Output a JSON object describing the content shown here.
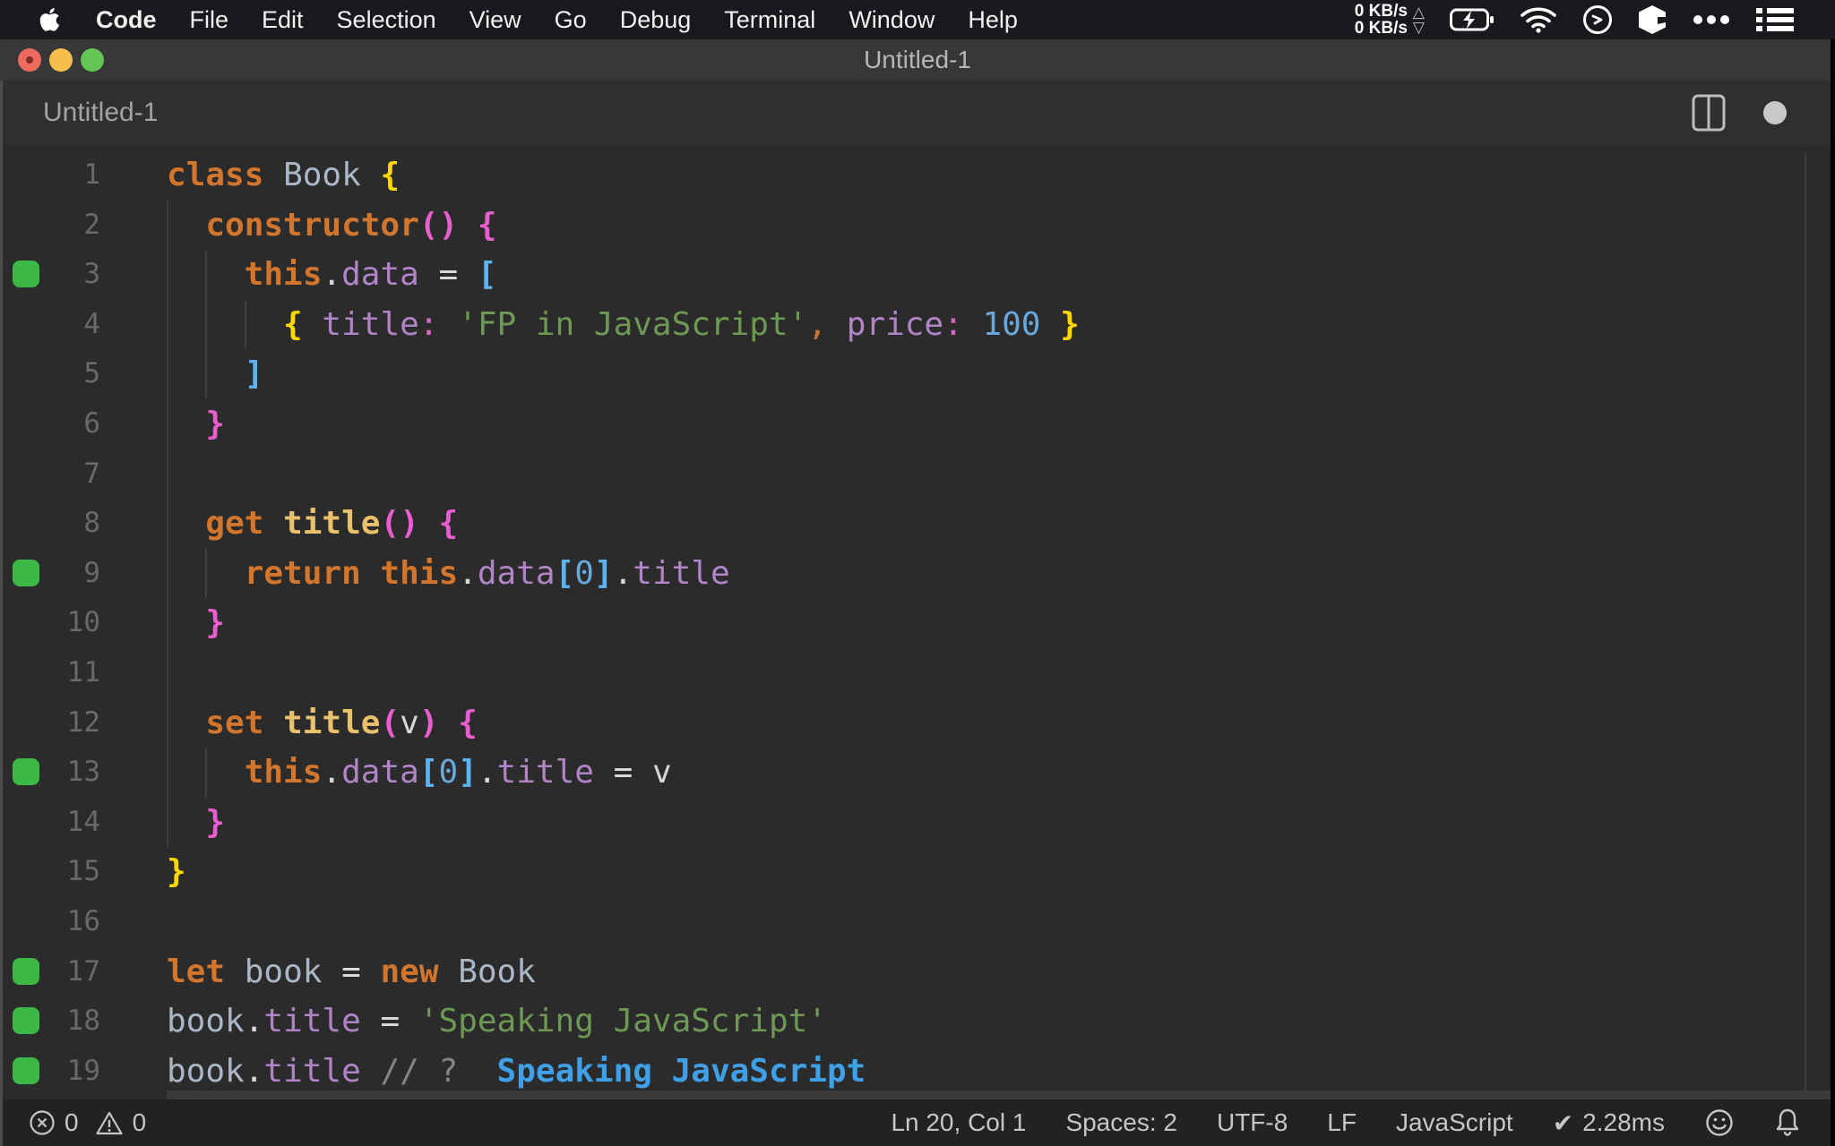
{
  "menubar": {
    "app_menu": "Code",
    "items": [
      "File",
      "Edit",
      "Selection",
      "View",
      "Go",
      "Debug",
      "Terminal",
      "Window",
      "Help"
    ],
    "network": {
      "up_value": "0 KB/s",
      "down_value": "0 KB/s",
      "up_arrow": "△",
      "down_arrow": "▽"
    }
  },
  "titlebar": {
    "title": "Untitled-1"
  },
  "tabbar": {
    "label": "Untitled-1"
  },
  "editor": {
    "lines": [
      {
        "n": 1,
        "mark": false,
        "guides": 0,
        "tokens": [
          [
            "class",
            "kw"
          ],
          [
            " ",
            "pl"
          ],
          [
            "Book",
            "cls"
          ],
          [
            " ",
            "pl"
          ],
          [
            "{",
            "by"
          ]
        ]
      },
      {
        "n": 2,
        "mark": false,
        "guides": 1,
        "tokens": [
          [
            "  ",
            "pl"
          ],
          [
            "constructor",
            "kw"
          ],
          [
            "(",
            "bp"
          ],
          [
            ")",
            "bp"
          ],
          [
            " ",
            "pl"
          ],
          [
            "{",
            "bp"
          ]
        ]
      },
      {
        "n": 3,
        "mark": true,
        "guides": 2,
        "tokens": [
          [
            "    ",
            "pl"
          ],
          [
            "this",
            "kw"
          ],
          [
            ".",
            "pn"
          ],
          [
            "data",
            "prop"
          ],
          [
            " ",
            "pl"
          ],
          [
            "=",
            "op"
          ],
          [
            " ",
            "pl"
          ],
          [
            "[",
            "bb"
          ]
        ]
      },
      {
        "n": 4,
        "mark": false,
        "guides": 3,
        "tokens": [
          [
            "      ",
            "pl"
          ],
          [
            "{",
            "by"
          ],
          [
            " ",
            "pl"
          ],
          [
            "title",
            "prop"
          ],
          [
            ":",
            "co"
          ],
          [
            " ",
            "pl"
          ],
          [
            "'FP in JavaScript'",
            "str"
          ],
          [
            ",",
            "cm"
          ],
          [
            " ",
            "pl"
          ],
          [
            "price",
            "prop"
          ],
          [
            ":",
            "co"
          ],
          [
            " ",
            "pl"
          ],
          [
            "100",
            "num"
          ],
          [
            " ",
            "pl"
          ],
          [
            "}",
            "by"
          ]
        ]
      },
      {
        "n": 5,
        "mark": false,
        "guides": 2,
        "tokens": [
          [
            "    ",
            "pl"
          ],
          [
            "]",
            "bb"
          ]
        ]
      },
      {
        "n": 6,
        "mark": false,
        "guides": 1,
        "tokens": [
          [
            "  ",
            "pl"
          ],
          [
            "}",
            "bp"
          ]
        ]
      },
      {
        "n": 7,
        "mark": false,
        "guides": 1,
        "tokens": []
      },
      {
        "n": 8,
        "mark": false,
        "guides": 1,
        "tokens": [
          [
            "  ",
            "pl"
          ],
          [
            "get",
            "kw"
          ],
          [
            " ",
            "pl"
          ],
          [
            "title",
            "gold"
          ],
          [
            "(",
            "bp"
          ],
          [
            ")",
            "bp"
          ],
          [
            " ",
            "pl"
          ],
          [
            "{",
            "bp"
          ]
        ]
      },
      {
        "n": 9,
        "mark": true,
        "guides": 2,
        "tokens": [
          [
            "    ",
            "pl"
          ],
          [
            "return",
            "kw"
          ],
          [
            " ",
            "pl"
          ],
          [
            "this",
            "kw"
          ],
          [
            ".",
            "pn"
          ],
          [
            "data",
            "prop"
          ],
          [
            "[",
            "bb"
          ],
          [
            "0",
            "num"
          ],
          [
            "]",
            "bb"
          ],
          [
            ".",
            "pn"
          ],
          [
            "title",
            "prop"
          ]
        ]
      },
      {
        "n": 10,
        "mark": false,
        "guides": 1,
        "tokens": [
          [
            "  ",
            "pl"
          ],
          [
            "}",
            "bp"
          ]
        ]
      },
      {
        "n": 11,
        "mark": false,
        "guides": 1,
        "tokens": []
      },
      {
        "n": 12,
        "mark": false,
        "guides": 1,
        "tokens": [
          [
            "  ",
            "pl"
          ],
          [
            "set",
            "kw"
          ],
          [
            " ",
            "pl"
          ],
          [
            "title",
            "gold"
          ],
          [
            "(",
            "bp"
          ],
          [
            "v",
            "vr"
          ],
          [
            ")",
            "bp"
          ],
          [
            " ",
            "pl"
          ],
          [
            "{",
            "bp"
          ]
        ]
      },
      {
        "n": 13,
        "mark": true,
        "guides": 2,
        "tokens": [
          [
            "    ",
            "pl"
          ],
          [
            "this",
            "kw"
          ],
          [
            ".",
            "pn"
          ],
          [
            "data",
            "prop"
          ],
          [
            "[",
            "bb"
          ],
          [
            "0",
            "num"
          ],
          [
            "]",
            "bb"
          ],
          [
            ".",
            "pn"
          ],
          [
            "title",
            "prop"
          ],
          [
            " ",
            "pl"
          ],
          [
            "=",
            "op"
          ],
          [
            " ",
            "pl"
          ],
          [
            "v",
            "vr"
          ]
        ]
      },
      {
        "n": 14,
        "mark": false,
        "guides": 1,
        "tokens": [
          [
            "  ",
            "pl"
          ],
          [
            "}",
            "bp"
          ]
        ]
      },
      {
        "n": 15,
        "mark": false,
        "guides": 0,
        "tokens": [
          [
            "}",
            "by"
          ]
        ]
      },
      {
        "n": 16,
        "mark": false,
        "guides": 0,
        "tokens": []
      },
      {
        "n": 17,
        "mark": true,
        "guides": 0,
        "tokens": [
          [
            "let",
            "kw"
          ],
          [
            " ",
            "pl"
          ],
          [
            "book",
            "cls"
          ],
          [
            " ",
            "pl"
          ],
          [
            "=",
            "op"
          ],
          [
            " ",
            "pl"
          ],
          [
            "new",
            "kw"
          ],
          [
            " ",
            "pl"
          ],
          [
            "Book",
            "cls"
          ]
        ]
      },
      {
        "n": 18,
        "mark": true,
        "guides": 0,
        "tokens": [
          [
            "book",
            "cls"
          ],
          [
            ".",
            "pn"
          ],
          [
            "title",
            "prop"
          ],
          [
            " ",
            "pl"
          ],
          [
            "=",
            "op"
          ],
          [
            " ",
            "pl"
          ],
          [
            "'Speaking JavaScript'",
            "str"
          ]
        ]
      },
      {
        "n": 19,
        "mark": true,
        "guides": 0,
        "tokens": [
          [
            "book",
            "cls"
          ],
          [
            ".",
            "pn"
          ],
          [
            "title",
            "prop"
          ],
          [
            " ",
            "pl"
          ],
          [
            "//",
            "com"
          ],
          [
            " ",
            "pl"
          ],
          [
            "?",
            "com"
          ],
          [
            "  ",
            "pl"
          ],
          [
            "Speaking JavaScript",
            "qk"
          ]
        ]
      }
    ]
  },
  "statusbar": {
    "errors": "0",
    "warnings": "0",
    "items": [
      {
        "name": "cursor-position",
        "label": "Ln 20, Col 1"
      },
      {
        "name": "indentation",
        "label": "Spaces: 2"
      },
      {
        "name": "encoding",
        "label": "UTF-8"
      },
      {
        "name": "eol-sequence",
        "label": "LF"
      },
      {
        "name": "language-mode",
        "label": "JavaScript"
      }
    ],
    "performance": {
      "check": "✔",
      "time": "2.28ms"
    }
  },
  "colors": {
    "keyword_orange": "#d2752d",
    "property_purple": "#b184c8",
    "string_green": "#6e9955",
    "number_blue": "#68a8dc",
    "bracket_yellow": "#ffd702",
    "bracket_pink": "#e85dcf",
    "bracket_blue": "#5cb3ef",
    "quokka_value_blue": "#3fa0e8",
    "coverage_green": "#3cb944",
    "accessor_gold": "#eac06a",
    "editor_bg": "#2b2b2b"
  }
}
